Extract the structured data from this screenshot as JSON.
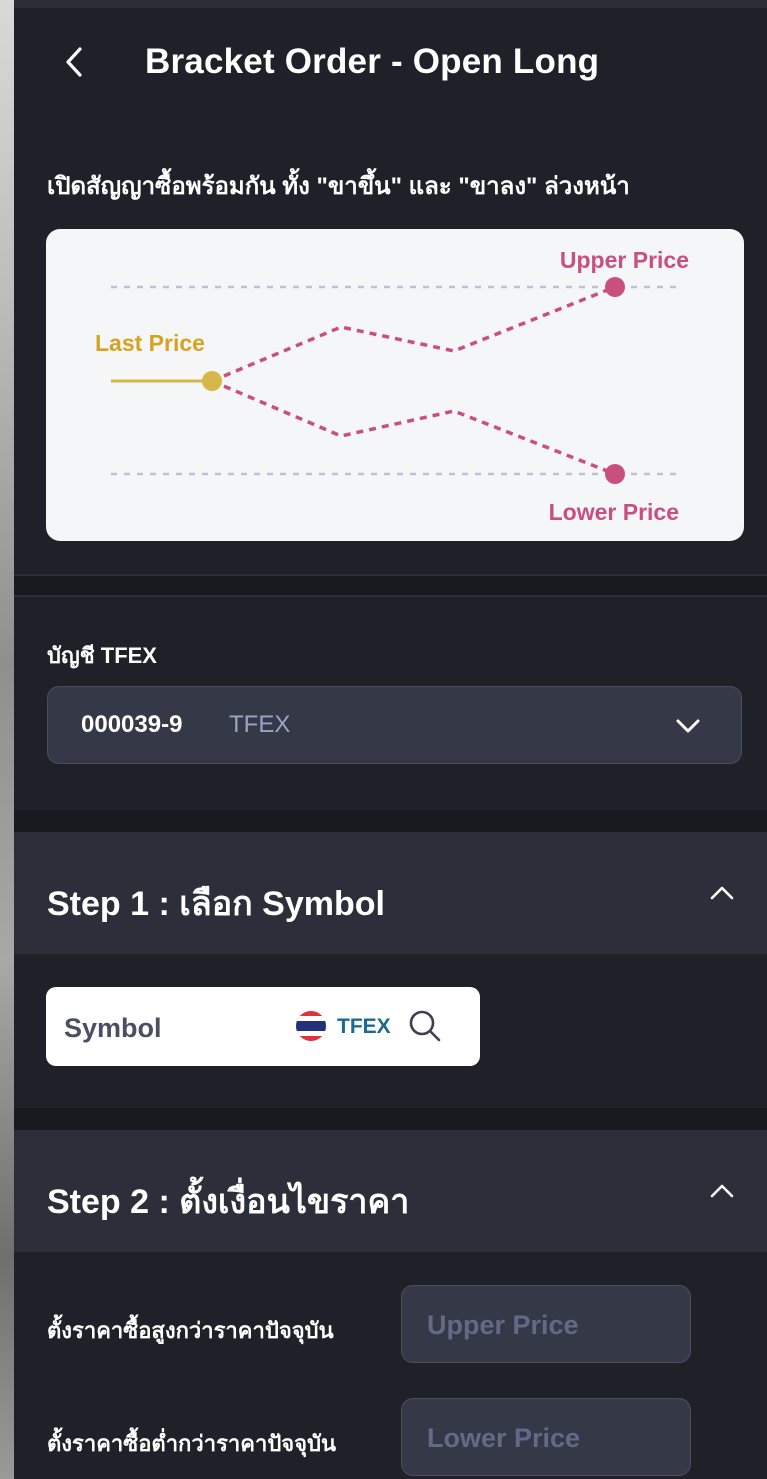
{
  "header": {
    "title": "Bracket Order - Open Long",
    "back_icon": "chevron-left-icon"
  },
  "intro": {
    "subtitle": "เปิดสัญญาซื้อพร้อมกัน ทั้ง \"ขาขึ้น\" และ \"ขาลง\" ล่วงหน้า"
  },
  "illustration": {
    "upper_label": "Upper Price",
    "last_label": "Last Price",
    "lower_label": "Lower Price",
    "colors": {
      "upper_lower": "#c94f7f",
      "last": "#d6a321",
      "guide": "#b9c2d6"
    }
  },
  "account": {
    "label": "บัญชี TFEX",
    "number": "000039-9",
    "type": "TFEX",
    "dropdown_icon": "chevron-down-icon"
  },
  "step1": {
    "title": "Step 1 : เลือก Symbol",
    "collapse_icon": "chevron-up-icon",
    "symbol_placeholder": "Symbol",
    "market_flag": "thai-flag-icon",
    "market": "TFEX",
    "search_icon": "search-icon"
  },
  "step2": {
    "title": "Step 2 : ตั้งเงื่อนไขราคา",
    "collapse_icon": "chevron-up-icon",
    "upper_label": "ตั้งราคาซื้อสูงกว่าราคาปัจจุบัน",
    "upper_placeholder": "Upper Price",
    "lower_label": "ตั้งราคาซื้อต่ำกว่าราคาปัจจุบัน",
    "lower_placeholder": "Lower Price"
  }
}
